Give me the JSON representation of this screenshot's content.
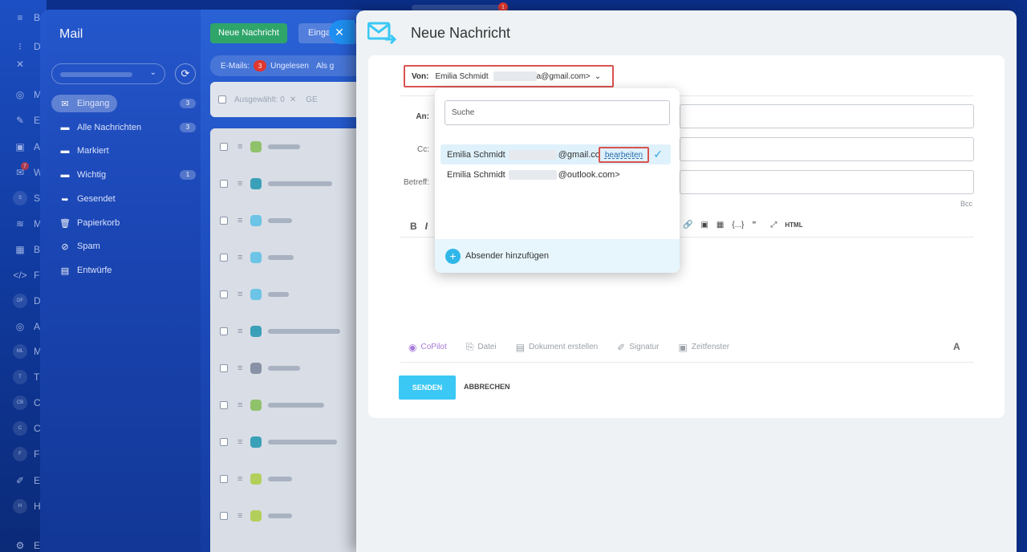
{
  "app_rail": {
    "items": [
      {
        "icon": "menu-icon",
        "label": "B"
      },
      {
        "icon": "list-icon",
        "label": "D"
      },
      {
        "icon": "close-icon",
        "label": ""
      },
      {
        "icon": "target-icon",
        "label": "M"
      },
      {
        "icon": "edit-icon",
        "label": "E"
      },
      {
        "icon": "app-icon",
        "label": "A"
      },
      {
        "icon": "mail-icon",
        "label": "W",
        "badge": "7"
      },
      {
        "icon": "s-circle",
        "label": "S"
      },
      {
        "icon": "waves-icon",
        "label": "M"
      },
      {
        "icon": "building-icon",
        "label": "B"
      },
      {
        "icon": "code-icon",
        "label": "F"
      },
      {
        "icon": "df-circle",
        "label": "D"
      },
      {
        "icon": "target-icon",
        "label": "A"
      },
      {
        "icon": "ml-circle",
        "label": "M"
      },
      {
        "icon": "t-circle",
        "label": "T"
      },
      {
        "icon": "cb-circle",
        "label": "C"
      },
      {
        "icon": "c-circle",
        "label": "C"
      },
      {
        "icon": "f-circle",
        "label": "F"
      },
      {
        "icon": "pen-icon",
        "label": "E"
      },
      {
        "icon": "h-circle",
        "label": "H"
      },
      {
        "icon": "gear-icon",
        "label": "E"
      }
    ]
  },
  "mail": {
    "title": "Mail",
    "folders": [
      {
        "label": "Eingang",
        "count": "3",
        "icon": "inbox-icon"
      },
      {
        "label": "Alle Nachrichten",
        "count": "3",
        "icon": "folder-icon"
      },
      {
        "label": "Markiert",
        "count": "",
        "icon": "folder-icon"
      },
      {
        "label": "Wichtig",
        "count": "1",
        "icon": "folder-icon"
      },
      {
        "label": "Gesendet",
        "count": "",
        "icon": "sent-icon"
      },
      {
        "label": "Papierkorb",
        "count": "",
        "icon": "trash-icon"
      },
      {
        "label": "Spam",
        "count": "",
        "icon": "spam-icon"
      },
      {
        "label": "Entwürfe",
        "count": "",
        "icon": "draft-icon"
      }
    ]
  },
  "list": {
    "new_button": "Neue Nachricht",
    "inbox_button": "Einga",
    "emails_label": "E-Mails:",
    "unread_count": "3",
    "unread_label": "Ungelesen",
    "more_label": "Als g",
    "selected_label": "Ausgewählt: 0",
    "selected_extra": "GE"
  },
  "compose": {
    "title": "Neue Nachricht",
    "from_label": "Von:",
    "from_name": "Emilia Schmidt",
    "from_email_tail": "a@gmail.com>",
    "to_label": "An:",
    "cc_label": "Cc:",
    "subject_label": "Betreff:",
    "bcc_label": "Bcc",
    "toolbar_left": [
      "B",
      "I"
    ],
    "toolbar_right": [
      "link",
      "image",
      "table",
      "{...}",
      "quote",
      "expand",
      "HTML"
    ],
    "actions": [
      {
        "label": "CoPilot",
        "icon": "copilot-icon"
      },
      {
        "label": "Datei",
        "icon": "paperclip-icon"
      },
      {
        "label": "Dokument erstellen",
        "icon": "document-icon"
      },
      {
        "label": "Signatur",
        "icon": "signature-icon"
      },
      {
        "label": "Zeitfenster",
        "icon": "calendar-icon"
      }
    ],
    "font_label": "A",
    "send_label": "SENDEN",
    "cancel_label": "ABBRECHEN"
  },
  "sender_popup": {
    "search_placeholder": "Suche",
    "options": [
      {
        "name": "Emilia Schmidt",
        "email_tail": "@gmail.co",
        "edit_label": "bearbeiten",
        "selected": true
      },
      {
        "name": "Emilia Schmidt",
        "email_tail": "@outlook.com>",
        "selected": false
      }
    ],
    "add_sender_label": "Absender hinzufügen"
  },
  "top_badge": "1",
  "colors": {
    "accent": "#3bc8f5",
    "highlight": "#d9534f",
    "send": "#3bc8f5",
    "new_message": "#2fa56a",
    "badge": "#e0372f"
  }
}
